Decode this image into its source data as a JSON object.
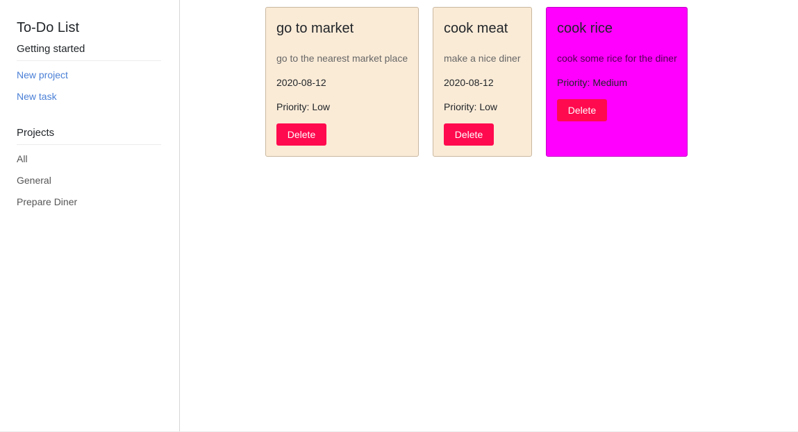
{
  "sidebar": {
    "title": "To-Do List",
    "getting_started": {
      "heading": "Getting started",
      "links": [
        "New project",
        "New task"
      ]
    },
    "projects": {
      "heading": "Projects",
      "items": [
        "All",
        "General",
        "Prepare Diner"
      ]
    }
  },
  "tasks": [
    {
      "title": "go to market",
      "description": "go to the nearest market place",
      "date": "2020-08-12",
      "priority": "Priority: Low",
      "delete_label": "Delete"
    },
    {
      "title": "cook meat",
      "description": "make a nice diner",
      "date": "2020-08-12",
      "priority": "Priority: Low",
      "delete_label": "Delete"
    },
    {
      "title": "cook rice",
      "description": "cook some rice for the diner",
      "priority": "Priority: Medium",
      "delete_label": "Delete"
    }
  ],
  "colors": {
    "low_priority_bg": "#faebd7",
    "medium_priority_bg": "#ff00ff",
    "delete_button": "#ff0a4e",
    "link": "#4a7fd6"
  }
}
